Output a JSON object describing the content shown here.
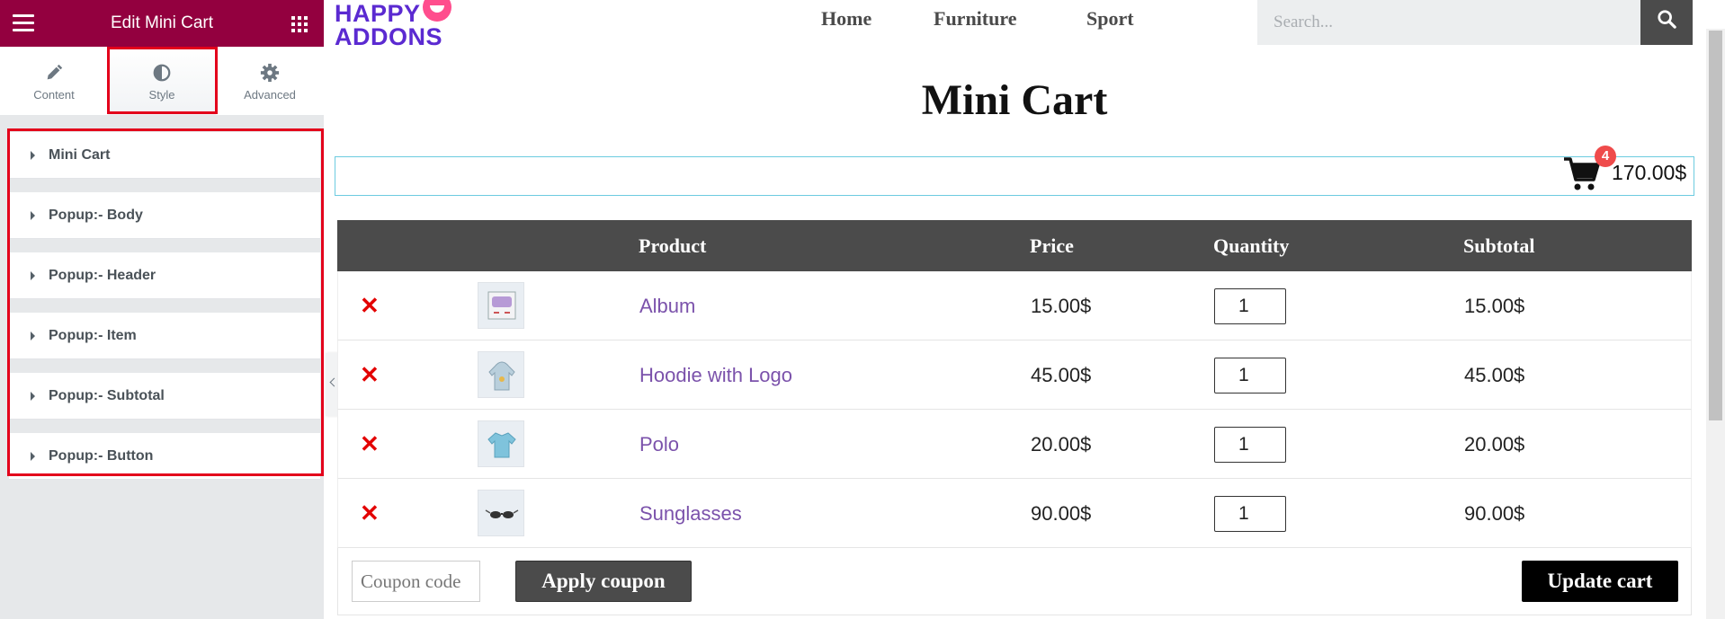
{
  "panel": {
    "title": "Edit Mini Cart",
    "tabs": [
      {
        "label": "Content",
        "icon": "pencil-icon"
      },
      {
        "label": "Style",
        "icon": "half-circle-icon",
        "active": true
      },
      {
        "label": "Advanced",
        "icon": "gear-icon"
      }
    ],
    "sections": [
      {
        "label": "Mini Cart"
      },
      {
        "label": "Popup:- Body"
      },
      {
        "label": "Popup:- Header"
      },
      {
        "label": "Popup:- Item"
      },
      {
        "label": "Popup:- Subtotal"
      },
      {
        "label": "Popup:- Button"
      }
    ],
    "highlight_color": "#e3001b",
    "header_color": "#93003f"
  },
  "site": {
    "logo": {
      "line1": "HAPPY",
      "line2": "ADDONS"
    },
    "nav": [
      "Home",
      "Furniture",
      "Sport"
    ],
    "search": {
      "placeholder": "Search..."
    }
  },
  "page": {
    "title": "Mini Cart",
    "mini_cart": {
      "count": "4",
      "total": "170.00$"
    }
  },
  "cart": {
    "headers": {
      "product": "Product",
      "price": "Price",
      "quantity": "Quantity",
      "subtotal": "Subtotal"
    },
    "items": [
      {
        "name": "Album",
        "price": "15.00$",
        "quantity": "1",
        "subtotal": "15.00$"
      },
      {
        "name": "Hoodie with Logo",
        "price": "45.00$",
        "quantity": "1",
        "subtotal": "45.00$"
      },
      {
        "name": "Polo",
        "price": "20.00$",
        "quantity": "1",
        "subtotal": "20.00$"
      },
      {
        "name": "Sunglasses",
        "price": "90.00$",
        "quantity": "1",
        "subtotal": "90.00$"
      }
    ],
    "remove_symbol": "✕",
    "coupon_placeholder": "Coupon code",
    "apply_coupon_label": "Apply coupon",
    "update_cart_label": "Update cart"
  }
}
